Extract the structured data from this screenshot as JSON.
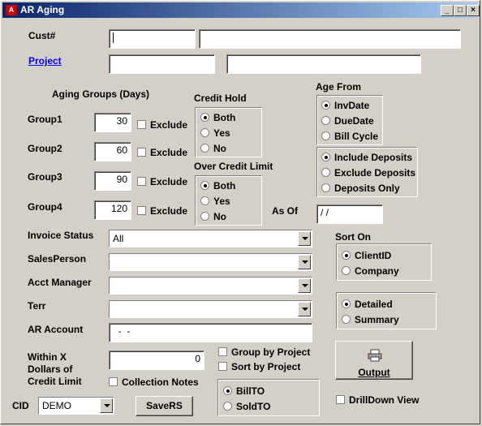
{
  "window": {
    "title": "AR Aging",
    "min": "_",
    "max": "□",
    "close": "×"
  },
  "cust": {
    "label": "Cust#",
    "value": "",
    "name": ""
  },
  "project": {
    "label": "Project",
    "value": "",
    "name": ""
  },
  "aging": {
    "heading": "Aging Groups (Days)",
    "exclude_label": "Exclude",
    "groups": [
      {
        "label": "Group1",
        "value": "30"
      },
      {
        "label": "Group2",
        "value": "60"
      },
      {
        "label": "Group3",
        "value": "90"
      },
      {
        "label": "Group4",
        "value": "120"
      }
    ]
  },
  "credit_hold": {
    "heading": "Credit Hold",
    "options": [
      "Both",
      "Yes",
      "No"
    ],
    "selected": "Both"
  },
  "over_credit": {
    "heading": "Over Credit Limit",
    "options": [
      "Both",
      "Yes",
      "No"
    ],
    "selected": "Both"
  },
  "age_from": {
    "heading": "Age From",
    "options": [
      "InvDate",
      "DueDate",
      "Bill Cycle"
    ],
    "selected": "InvDate"
  },
  "deposits": {
    "options": [
      "Include Deposits",
      "Exclude Deposits",
      "Deposits Only"
    ],
    "selected": "Include Deposits"
  },
  "as_of": {
    "label": "As Of",
    "value": " / /"
  },
  "filters": {
    "invoice_status": {
      "label": "Invoice Status",
      "value": "All"
    },
    "salesperson": {
      "label": "SalesPerson",
      "value": ""
    },
    "acct_manager": {
      "label": "Acct Manager",
      "value": ""
    },
    "terr": {
      "label": "Terr",
      "value": ""
    },
    "ar_account": {
      "label": "AR Account",
      "value": "  -  -"
    }
  },
  "within": {
    "label_lines": [
      "Within X",
      "Dollars of",
      "Credit Limit"
    ],
    "value": "0"
  },
  "collection_notes": "Collection Notes",
  "group_by_project": "Group by Project",
  "sort_by_project": "Sort  by Project",
  "sort_on": {
    "heading": "Sort On",
    "options": [
      "ClientID",
      "Company"
    ],
    "selected": "ClientID"
  },
  "detail": {
    "options": [
      "Detailed",
      "Summary"
    ],
    "selected": "Detailed"
  },
  "bill": {
    "options": [
      "BillTO",
      "SoldTO"
    ],
    "selected": "BillTO"
  },
  "output_button": "Output",
  "drilldown": "DrillDown View",
  "cid": {
    "label": "CID",
    "value": "DEMO"
  },
  "savers_button": "SaveRS"
}
